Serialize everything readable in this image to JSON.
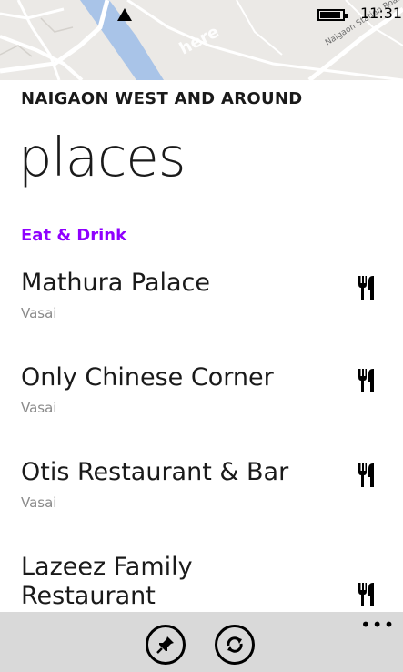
{
  "status_bar": {
    "time": "11:31",
    "signal_icon": "signal-icon",
    "battery_icon": "battery-icon",
    "battery_level": 0.85
  },
  "map": {
    "watermark": "here",
    "street_label": "Naigaon Station Road"
  },
  "header": {
    "region_title": "NAIGAON WEST AND AROUND",
    "page_title": "places"
  },
  "section": {
    "title": "Eat & Drink",
    "accent_color": "#8f00ff"
  },
  "places": [
    {
      "name": "Mathura Palace",
      "locality": "Vasai",
      "icon": "cutlery-icon"
    },
    {
      "name": "Only Chinese Corner",
      "locality": "Vasai",
      "icon": "cutlery-icon"
    },
    {
      "name": "Otis Restaurant & Bar",
      "locality": "Vasai",
      "icon": "cutlery-icon"
    },
    {
      "name": "Lazeez Family Restaurant",
      "locality": "",
      "icon": "cutlery-icon"
    }
  ],
  "app_bar": {
    "buttons": [
      {
        "icon": "pin-icon"
      },
      {
        "icon": "refresh-icon"
      }
    ],
    "more": "•••",
    "background": "#d9d9d9"
  }
}
